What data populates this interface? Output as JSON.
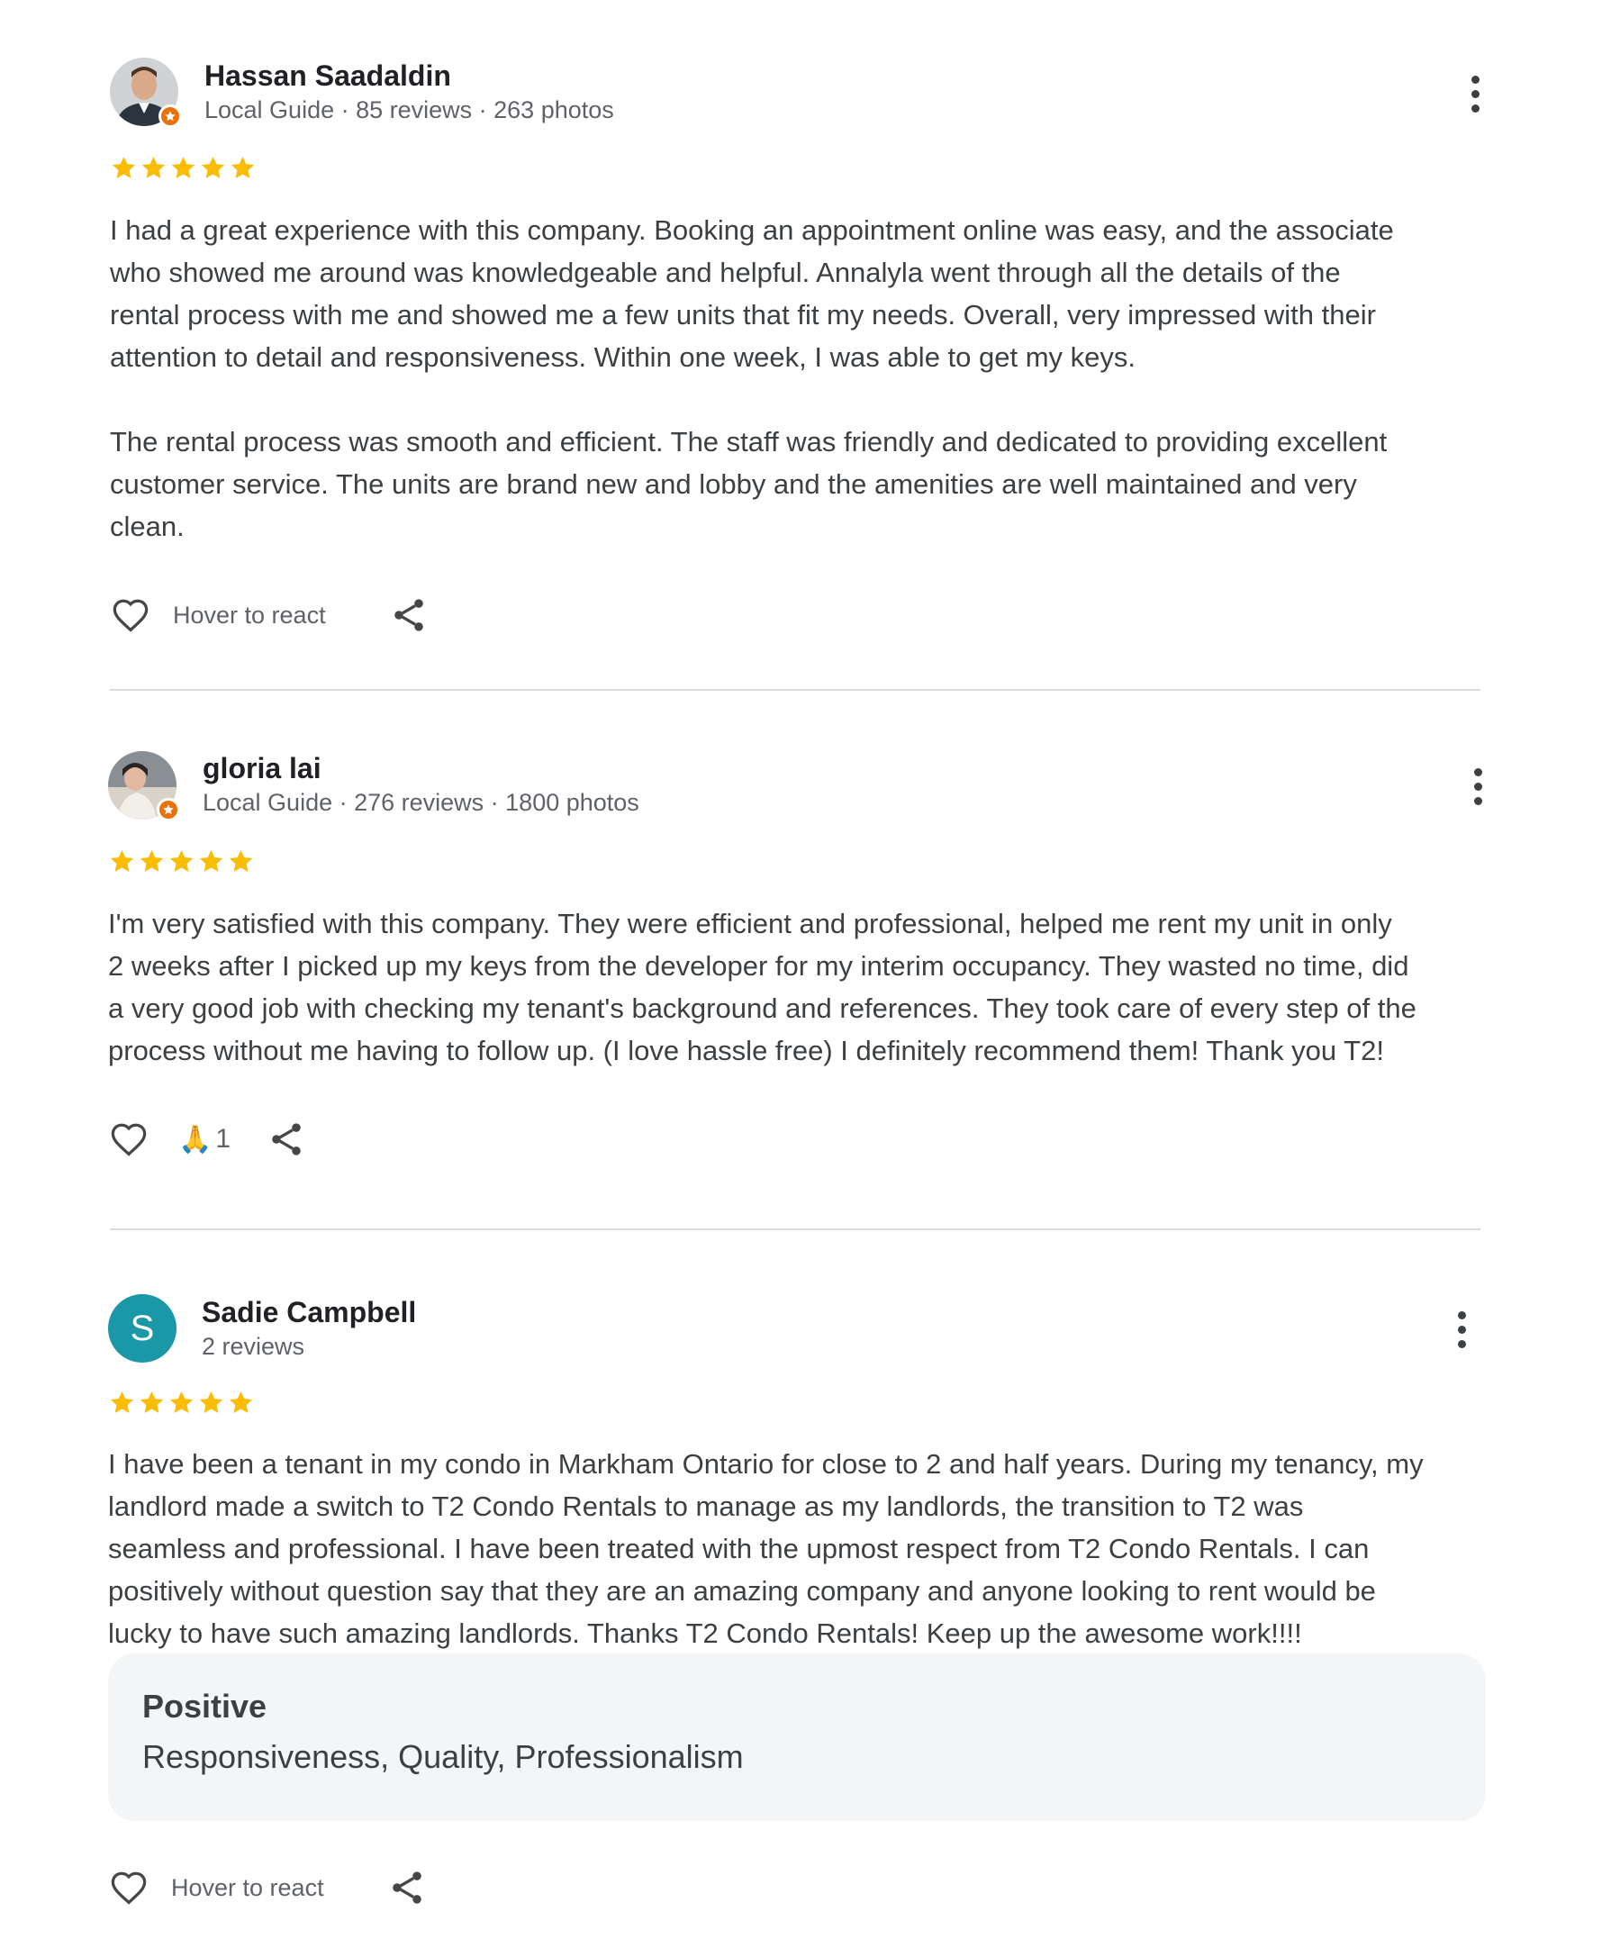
{
  "reviews": [
    {
      "name": "Hassan Saadaldin",
      "meta": "Local Guide · 85 reviews · 263 photos",
      "rating": 5,
      "text": "I had a great experience with this company. Booking an appointment online was easy, and the associate\nwho showed me around was knowledgeable and helpful. Annalyla went through all the details of the\nrental process with me and showed me a few units that fit my needs. Overall, very impressed with their\nattention to detail and responsiveness. Within one week, I was able to get my keys.\n\nThe rental process was smooth and efficient. The staff was friendly and dedicated to providing excellent\ncustomer service. The units are brand new and lobby and the amenities are well maintained and very\nclean.",
      "react_label": "Hover to react"
    },
    {
      "name": "gloria lai",
      "meta": "Local Guide · 276 reviews · 1800 photos",
      "rating": 5,
      "text": "I'm very satisfied with this company. They were efficient and professional, helped me rent my unit in only\n2 weeks after I picked up my keys from the developer for my interim occupancy. They wasted no time, did\na very good job with checking my tenant's background and references. They took care of every step of the\nprocess without me having to follow up. (I love hassle free) I definitely recommend them! Thank you T2!",
      "reaction_emoji": "🙏",
      "reaction_count": "1"
    },
    {
      "name": "Sadie Campbell",
      "avatar_letter": "S",
      "meta": "2 reviews",
      "rating": 5,
      "text": "I have been a tenant in my condo in Markham Ontario for close to 2 and half years. During my tenancy, my\nlandlord made a switch to T2 Condo Rentals to manage as my landlords, the transition to T2 was\nseamless and professional. I have been treated with the upmost respect from T2 Condo Rentals. I can\npositively without question say that they are an amazing company and anyone looking to rent would be\nlucky to have such amazing landlords. Thanks T2 Condo Rentals! Keep up the awesome work!!!!",
      "highlights_title": "Positive",
      "highlights_body": "Responsiveness, Quality, Professionalism",
      "react_label": "Hover to react"
    }
  ],
  "colors": {
    "star": "#fbbc04",
    "avatar_letter_bg": "#1a98a8",
    "local_guide_badge": "#e8710a",
    "divider": "#dadce0"
  },
  "icons": [
    "more-vert-icon",
    "star-icon",
    "heart-icon",
    "share-icon",
    "local-guide-badge-icon"
  ]
}
